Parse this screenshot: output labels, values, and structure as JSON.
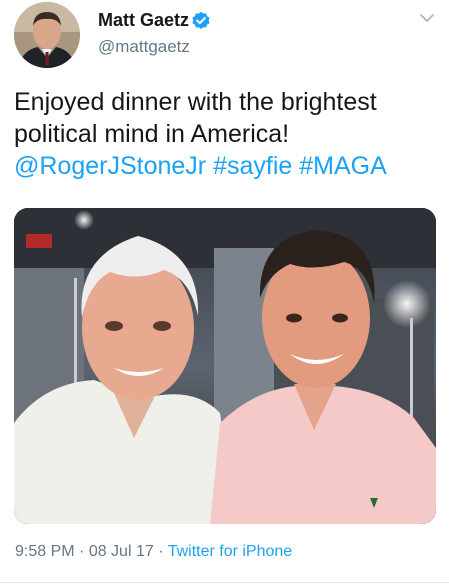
{
  "author": {
    "name": "Matt Gaetz",
    "handle": "@mattgaetz",
    "verified_icon": "verified-badge-icon",
    "avatar_icon": "avatar"
  },
  "tweet": {
    "text_line1": "Enjoyed dinner with the brightest",
    "text_line2": "political mind in America!",
    "mention": "@RogerJStoneJr",
    "hashtag1": "#sayfie",
    "hashtag2": "#MAGA"
  },
  "meta": {
    "time": "9:58 PM",
    "date": "08 Jul 17",
    "separator": " · ",
    "source": "Twitter for iPhone"
  },
  "colors": {
    "link": "#1da1f2",
    "muted": "#657786",
    "text": "#14171a",
    "verified": "#1da1f2"
  }
}
